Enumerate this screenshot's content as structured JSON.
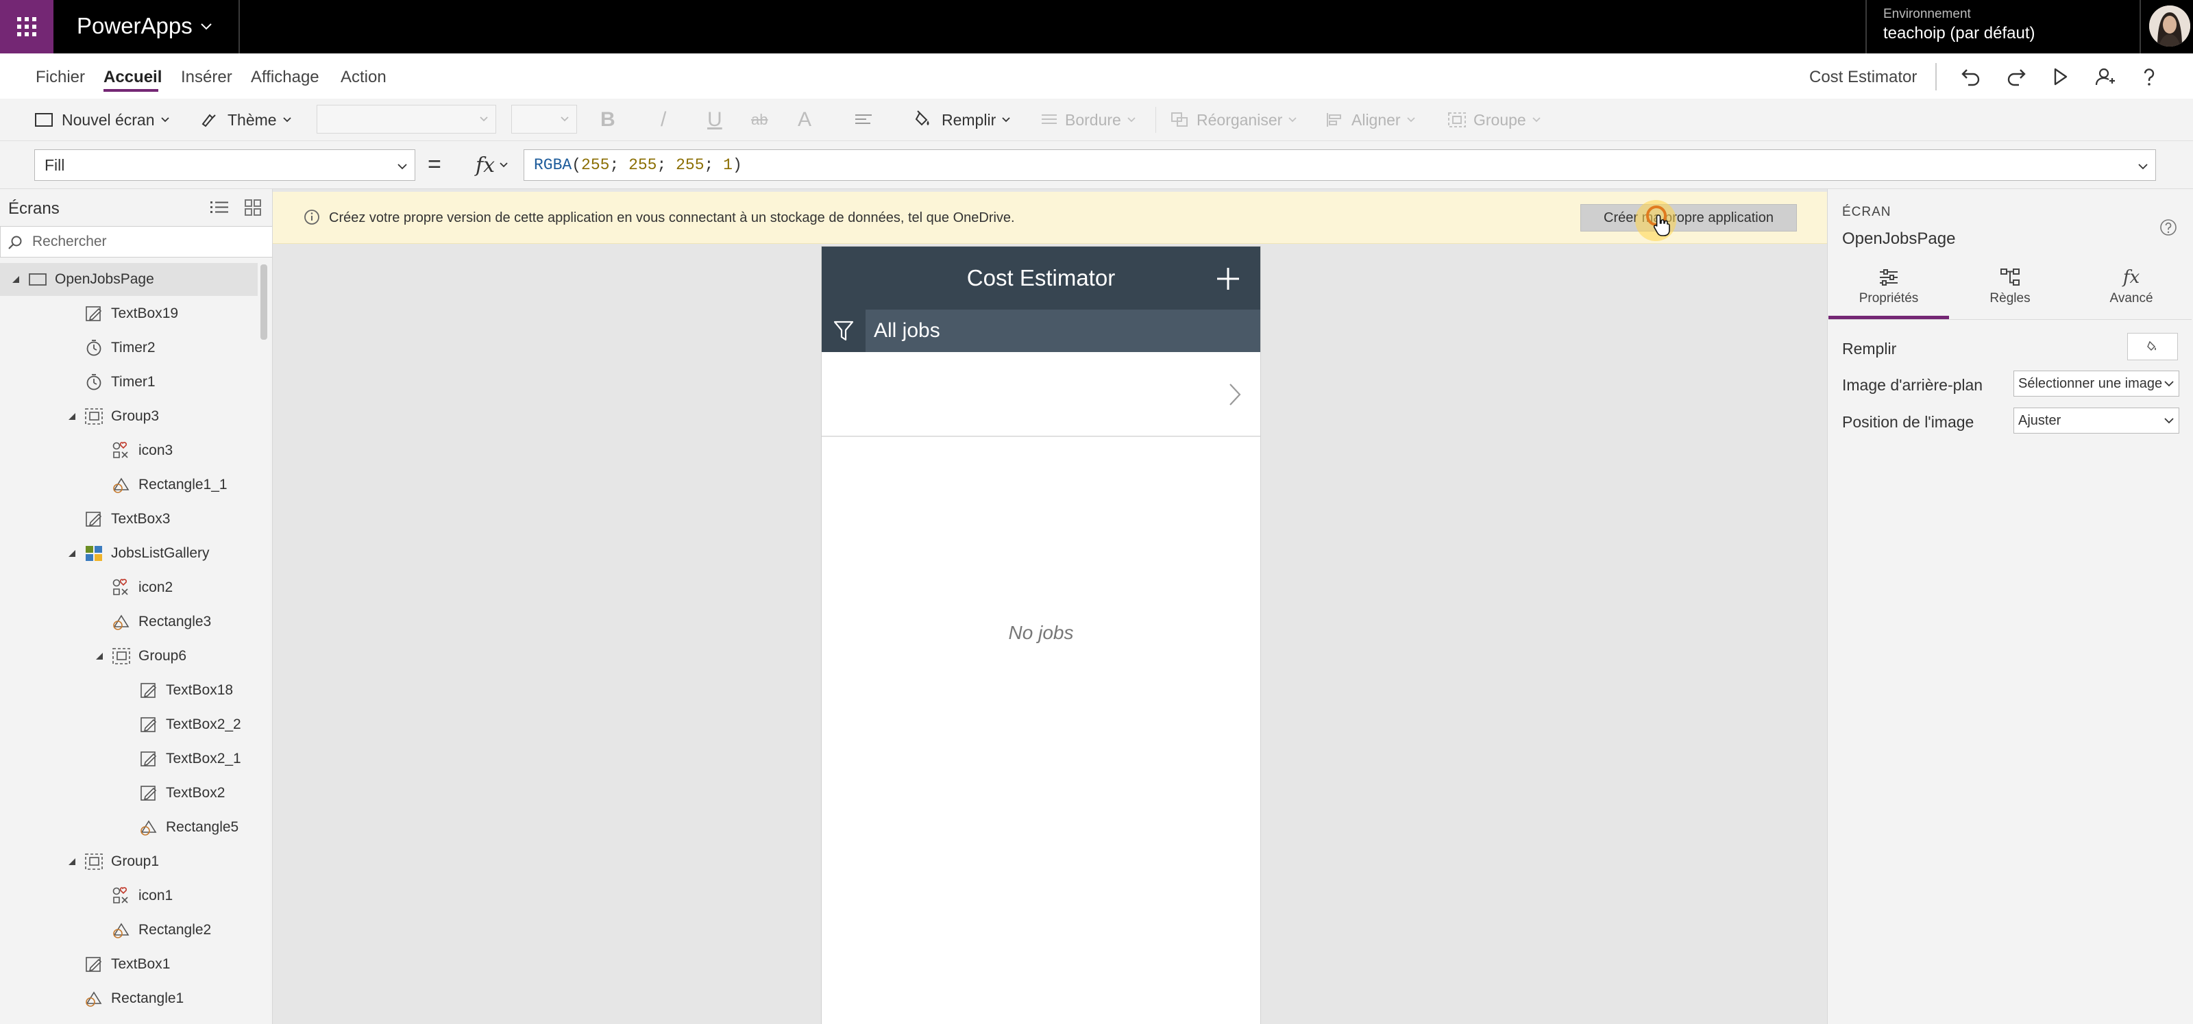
{
  "topbar": {
    "app_name": "PowerApps",
    "environment_label": "Environnement",
    "environment_value": "teachoip (par défaut)"
  },
  "menu": {
    "items": [
      "Fichier",
      "Accueil",
      "Insérer",
      "Affichage",
      "Action"
    ],
    "active": "Accueil",
    "app_title": "Cost Estimator"
  },
  "ribbon": {
    "new_screen": "Nouvel écran",
    "theme": "Thème",
    "bold": "B",
    "italic": "/",
    "underline": "U",
    "strikethrough": "ab",
    "font_size_glyph": "A",
    "fill": "Remplir",
    "border": "Bordure",
    "reorder": "Réorganiser",
    "align": "Aligner",
    "group": "Groupe"
  },
  "formula_bar": {
    "property": "Fill",
    "equals": "=",
    "fx": "fx",
    "formula": {
      "fn": "RGBA",
      "open": "(",
      "a1": "255",
      "s1": "; ",
      "a2": "255",
      "s2": "; ",
      "a3": "255",
      "s3": "; ",
      "a4": "1",
      "close": ")"
    }
  },
  "tree": {
    "title": "Écrans",
    "search_placeholder": "Rechercher",
    "items": [
      {
        "label": "OpenJobsPage",
        "type": "screen",
        "depth": 0,
        "expanded": true,
        "selected": true
      },
      {
        "label": "TextBox19",
        "type": "text",
        "depth": 1
      },
      {
        "label": "Timer2",
        "type": "timer",
        "depth": 1
      },
      {
        "label": "Timer1",
        "type": "timer",
        "depth": 1
      },
      {
        "label": "Group3",
        "type": "group",
        "depth": 1,
        "expanded": true
      },
      {
        "label": "icon3",
        "type": "icon",
        "depth": 2
      },
      {
        "label": "Rectangle1_1",
        "type": "shape",
        "depth": 2
      },
      {
        "label": "TextBox3",
        "type": "text",
        "depth": 1
      },
      {
        "label": "JobsListGallery",
        "type": "gallery",
        "depth": 1,
        "expanded": true
      },
      {
        "label": "icon2",
        "type": "icon",
        "depth": 2
      },
      {
        "label": "Rectangle3",
        "type": "shape",
        "depth": 2
      },
      {
        "label": "Group6",
        "type": "group",
        "depth": 2,
        "expanded": true
      },
      {
        "label": "TextBox18",
        "type": "text",
        "depth": 3
      },
      {
        "label": "TextBox2_2",
        "type": "text",
        "depth": 3
      },
      {
        "label": "TextBox2_1",
        "type": "text",
        "depth": 3
      },
      {
        "label": "TextBox2",
        "type": "text",
        "depth": 3
      },
      {
        "label": "Rectangle5",
        "type": "shape",
        "depth": 3
      },
      {
        "label": "Group1",
        "type": "group",
        "depth": 1,
        "expanded": true
      },
      {
        "label": "icon1",
        "type": "icon",
        "depth": 2
      },
      {
        "label": "Rectangle2",
        "type": "shape",
        "depth": 2
      },
      {
        "label": "TextBox1",
        "type": "text",
        "depth": 1
      },
      {
        "label": "Rectangle1",
        "type": "shape",
        "depth": 1
      }
    ]
  },
  "banner": {
    "text": "Créez votre propre version de cette application en vous connectant à un stockage de données, tel que OneDrive.",
    "button": "Créer ma propre application"
  },
  "phone": {
    "title": "Cost Estimator",
    "filter_label": "All jobs",
    "empty_text": "No jobs"
  },
  "properties": {
    "kind": "ÉCRAN",
    "name": "OpenJobsPage",
    "tabs": [
      {
        "label": "Propriétés",
        "icon": "sliders-icon",
        "active": true
      },
      {
        "label": "Règles",
        "icon": "rules-icon"
      },
      {
        "label": "Avancé",
        "icon": "fx-icon"
      }
    ],
    "fill_label": "Remplir",
    "bg_image_label": "Image d'arrière-plan",
    "bg_image_value": "Sélectionner une image",
    "image_position_label": "Position de l'image",
    "image_position_value": "Ajuster"
  },
  "colors": {
    "accent": "#742774",
    "topbar": "#000000",
    "phone_header": "#374551",
    "phone_filterbar": "#4a5967",
    "banner": "#fcf5d7"
  }
}
